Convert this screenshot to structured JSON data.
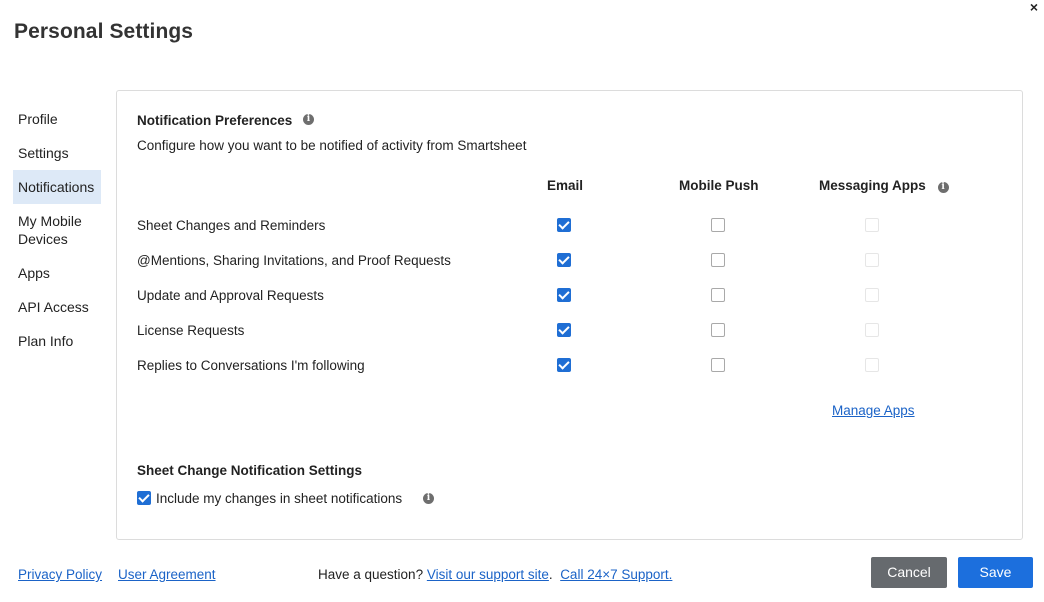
{
  "title": "Personal Settings",
  "close_glyph": "×",
  "nav": [
    {
      "label": "Profile"
    },
    {
      "label": "Settings"
    },
    {
      "label": "Notifications",
      "active": true
    },
    {
      "label": "My Mobile Devices"
    },
    {
      "label": "Apps"
    },
    {
      "label": "API Access"
    },
    {
      "label": "Plan Info"
    }
  ],
  "notification_prefs": {
    "heading": "Notification Preferences",
    "description": "Configure how you want to be notified of activity from Smartsheet",
    "columns": {
      "email": "Email",
      "mobile_push": "Mobile Push",
      "messaging_apps": "Messaging Apps"
    },
    "rows": [
      {
        "label": "Sheet Changes and Reminders",
        "email": true,
        "mobile_push": false,
        "messaging_apps": false
      },
      {
        "label": "@Mentions, Sharing Invitations, and Proof Requests",
        "email": true,
        "mobile_push": false,
        "messaging_apps": false
      },
      {
        "label": "Update and Approval Requests",
        "email": true,
        "mobile_push": false,
        "messaging_apps": false
      },
      {
        "label": "License Requests",
        "email": true,
        "mobile_push": false,
        "messaging_apps": false
      },
      {
        "label": "Replies to Conversations I'm following",
        "email": true,
        "mobile_push": false,
        "messaging_apps": false
      }
    ],
    "manage_apps": "Manage Apps"
  },
  "sheet_change": {
    "heading": "Sheet Change Notification Settings",
    "include_label": "Include my changes in sheet notifications",
    "include_checked": true
  },
  "footer": {
    "privacy": "Privacy Policy",
    "agreement": "User Agreement",
    "question": "Have a question?",
    "support_link": "Visit our support site",
    "call_link": "Call 24×7 Support.",
    "cancel": "Cancel",
    "save": "Save"
  },
  "colors": {
    "accent": "#1c6fdd",
    "link": "#1b63c7",
    "cancel_bg": "#666a6e",
    "nav_active_bg": "#dde9f7"
  }
}
